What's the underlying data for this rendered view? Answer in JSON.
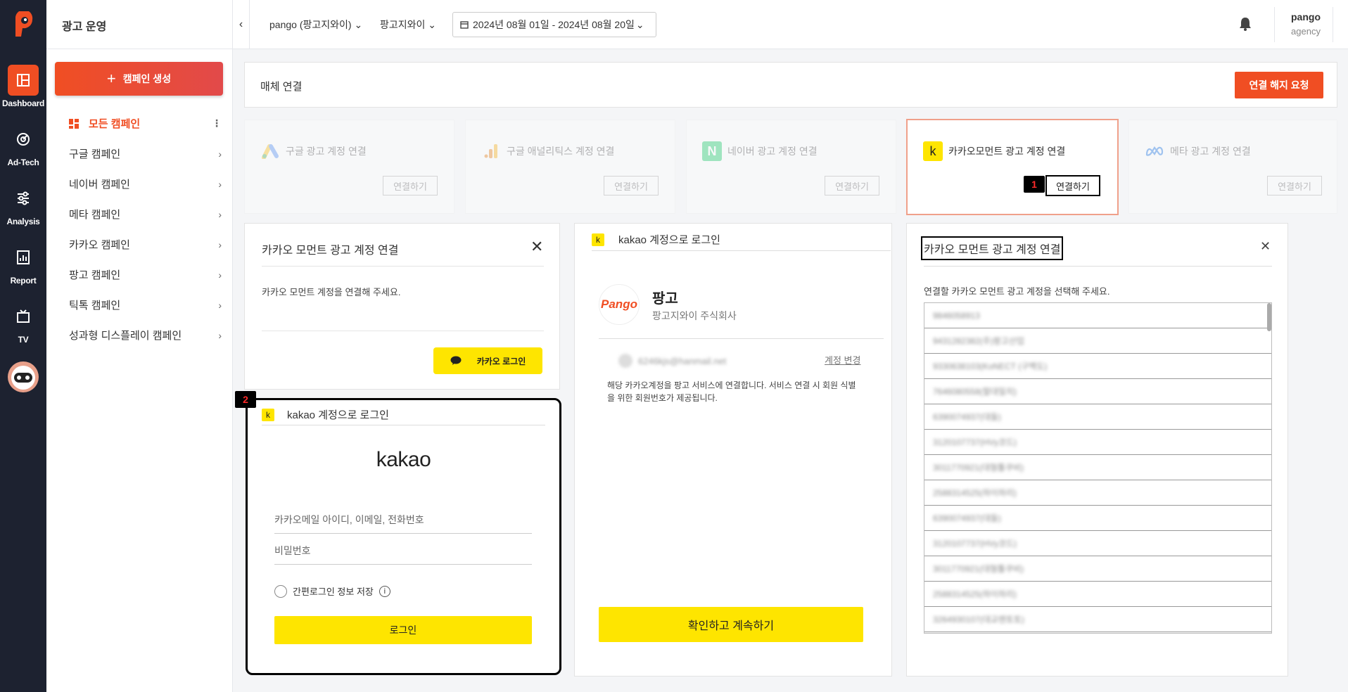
{
  "rail": {
    "items": [
      {
        "label": "Dashboard",
        "icon": "dashboard-icon"
      },
      {
        "label": "Ad-Tech",
        "icon": "adtech-icon"
      },
      {
        "label": "Analysis",
        "icon": "sliders-icon"
      },
      {
        "label": "Report",
        "icon": "report-icon"
      },
      {
        "label": "TV",
        "icon": "tv-icon"
      }
    ]
  },
  "sidebar": {
    "title": "광고 운영",
    "create_label": "캠페인 생성",
    "items": [
      {
        "label": "모든 캠페인"
      },
      {
        "label": "구글 캠페인"
      },
      {
        "label": "네이버 캠페인"
      },
      {
        "label": "메타 캠페인"
      },
      {
        "label": "카카오 캠페인"
      },
      {
        "label": "팡고 캠페인"
      },
      {
        "label": "틱톡 캠페인"
      },
      {
        "label": "성과형 디스플레이 캠페인"
      }
    ]
  },
  "topbar": {
    "account": "pango (팡고지와이)",
    "advertiser": "팡고지와이",
    "date_range": "2024년 08월 01일 - 2024년 08월 20일",
    "user_name": "pango",
    "user_role": "agency"
  },
  "media": {
    "title": "매체 연결",
    "disconnect_label": "연결 해지 요청",
    "cards": [
      {
        "label": "구글 광고 계정 연결",
        "button": "연결하기"
      },
      {
        "label": "구글 애널리틱스 계정 연결",
        "button": "연결하기"
      },
      {
        "label": "네이버 광고 계정 연결",
        "button": "연결하기"
      },
      {
        "label": "카카오모먼트 광고 계정 연결",
        "button": "연결하기"
      },
      {
        "label": "메타 광고 계정 연결",
        "button": "연결하기"
      }
    ]
  },
  "steps": {
    "one": "1",
    "two": "2"
  },
  "connect_panel": {
    "title": "카카오 모먼트 광고 계정 연결",
    "desc": "카카오 모먼트 계정을 연결해 주세요.",
    "kakao_login": "카카오 로그인"
  },
  "login_panel": {
    "header": "kakao 계정으로 로그인",
    "brand": "kakao",
    "id_placeholder": "카카오메일 아이디, 이메일, 전화번호",
    "pw_placeholder": "비밀번호",
    "remember": "간편로그인 정보 저장",
    "login": "로그인"
  },
  "consent_panel": {
    "header": "kakao 계정으로 로그인",
    "service_logo": "Pango",
    "service_name": "팡고",
    "company": "팡고지와이 주식회사",
    "email": "6246kjs@hanmail.net",
    "change": "계정 변경",
    "info": "해당 카카오계정을 팡고 서비스에 연결합니다. 서비스 연결 시 회원 식별을 위한 회원번호가 제공됩니다.",
    "continue": "확인하고 계속하기"
  },
  "select_panel": {
    "title": "카카오 모먼트 광고 계정 연결",
    "desc": "연결할 카카오 모먼트 광고 계정을 선택해 주세요.",
    "accounts": [
      "9846058913",
      "9431282382(주)팡고산업",
      "9330638103(KoNECT (구백도)",
      "7646080558(할대밀치)",
      "6390074937(대들)",
      "3120107737(HVy코드)",
      "3011770921(대형톨쿠비)",
      "2588314525(하이하리)",
      "6390074937(대들)",
      "3120107737(HVy코드)",
      "3011770921(대형톨쿠비)",
      "2588314525(하이하리)",
      "3264930107(대교렌토토)"
    ]
  },
  "colors": {
    "accent": "#f04e23",
    "kakao": "#fee500",
    "rail": "#1d2230"
  }
}
